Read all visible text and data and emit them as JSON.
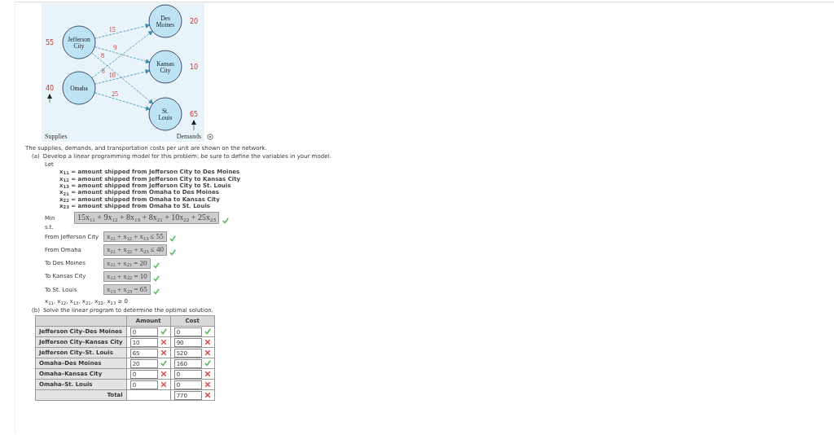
{
  "network": {
    "supplies_label": "Supplies",
    "demands_label": "Demands",
    "sources": [
      {
        "name": "Jefferson City",
        "supply": "55",
        "arcs": [
          {
            "cost": "15"
          },
          {
            "cost": "9"
          },
          {
            "cost": "8"
          }
        ]
      },
      {
        "name": "Omaha",
        "supply": "40",
        "arcs": [
          {
            "cost": "8"
          },
          {
            "cost": "10"
          },
          {
            "cost": "25"
          }
        ]
      }
    ],
    "destinations": [
      {
        "name": "Des Moines",
        "demand": "20"
      },
      {
        "name": "Kansas City",
        "demand": "10"
      },
      {
        "name": "St. Louis",
        "demand": "65"
      }
    ]
  },
  "intro": "The supplies, demands, and transportation costs per unit are shown on the network.",
  "part_a": {
    "marker": "(a)",
    "instruction": "Develop a linear programming model for this problem; be sure to define the variables in your model.",
    "let": "Let",
    "definitions": [
      "x$_{11}$ = amount shipped from Jefferson City to Des Moines",
      "x$_{12}$ = amount shipped from Jefferson City to Kansas City",
      "x$_{13}$ = amount shipped from Jefferson City to St. Louis",
      "x$_{21}$ = amount shipped from Omaha to Des Moines",
      "x$_{22}$ = amount shipped from Omaha to Kansas City",
      "x$_{23}$ = amount shipped from Omaha to St. Louis"
    ],
    "objective": {
      "label": "Min",
      "expression": "15x$_{11}$ + 9x$_{12}$ + 8x$_{13}$ + 8x$_{21}$ + 10x$_{22}$ + 25x$_{23}$",
      "correct": true
    },
    "subject_to": "s.t.",
    "constraints": [
      {
        "label": "From Jefferson City",
        "expression": "x$_{11}$ + x$_{12}$ + x$_{13}$ ≤ 55",
        "correct": true
      },
      {
        "label": "From Omaha",
        "expression": "x$_{21}$ + x$_{22}$ + x$_{23}$ ≤ 40",
        "correct": true
      },
      {
        "label": "To Des Moines",
        "expression": "x$_{11}$ + x$_{21}$ = 20",
        "correct": true
      },
      {
        "label": "To Kansas City",
        "expression": "x$_{12}$ + x$_{22}$ = 10",
        "correct": true
      },
      {
        "label": "To St. Louis",
        "expression": "x$_{13}$ + x$_{23}$ = 65",
        "correct": true
      }
    ],
    "nonnegativity": "x$_{11}$, x$_{12}$, x$_{13}$, x$_{21}$, x$_{22}$, x$_{23}$ ≥ 0"
  },
  "part_b": {
    "marker": "(b)",
    "instruction": "Solve the linear program to determine the optimal solution.",
    "columns": [
      "Amount",
      "Cost"
    ],
    "rows": [
      {
        "route": "Jefferson City–Des Moines",
        "amount": {
          "value": "0",
          "correct": true
        },
        "cost": {
          "value": "0",
          "correct": true
        }
      },
      {
        "route": "Jefferson City–Kansas City",
        "amount": {
          "value": "10",
          "correct": false
        },
        "cost": {
          "value": "90",
          "correct": false
        }
      },
      {
        "route": "Jefferson City–St. Louis",
        "amount": {
          "value": "65",
          "correct": false
        },
        "cost": {
          "value": "520",
          "correct": false
        }
      },
      {
        "route": "Omaha–Des Moines",
        "amount": {
          "value": "20",
          "correct": true
        },
        "cost": {
          "value": "160",
          "correct": true
        }
      },
      {
        "route": "Omaha–Kansas City",
        "amount": {
          "value": "0",
          "correct": false
        },
        "cost": {
          "value": "0",
          "correct": false
        }
      },
      {
        "route": "Omaha–St. Louis",
        "amount": {
          "value": "0",
          "correct": false
        },
        "cost": {
          "value": "0",
          "correct": false
        }
      }
    ],
    "total": {
      "label": "Total",
      "cost": {
        "value": "770",
        "correct": false
      }
    }
  }
}
